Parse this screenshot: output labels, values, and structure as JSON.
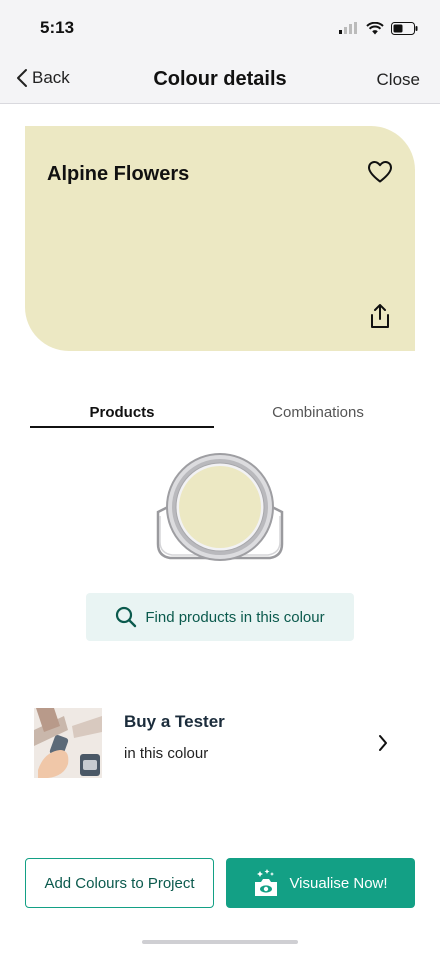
{
  "status_bar": {
    "time": "5:13"
  },
  "nav": {
    "back_label": "Back",
    "title": "Colour details",
    "close_label": "Close"
  },
  "colour": {
    "name": "Alpine Flowers",
    "swatch_hex": "#ece8c3"
  },
  "tabs": [
    {
      "label": "Products",
      "active": true
    },
    {
      "label": "Combinations",
      "active": false
    }
  ],
  "find_products": {
    "label": "Find products in this colour"
  },
  "tester": {
    "title": "Buy a Tester",
    "subtitle": "in this colour"
  },
  "actions": {
    "add_project_label": "Add Colours to Project",
    "visualise_label": "Visualise Now!"
  },
  "theme": {
    "accent": "#13a085",
    "accent_dark": "#0b5a4d",
    "find_bg": "#e9f4f3"
  }
}
